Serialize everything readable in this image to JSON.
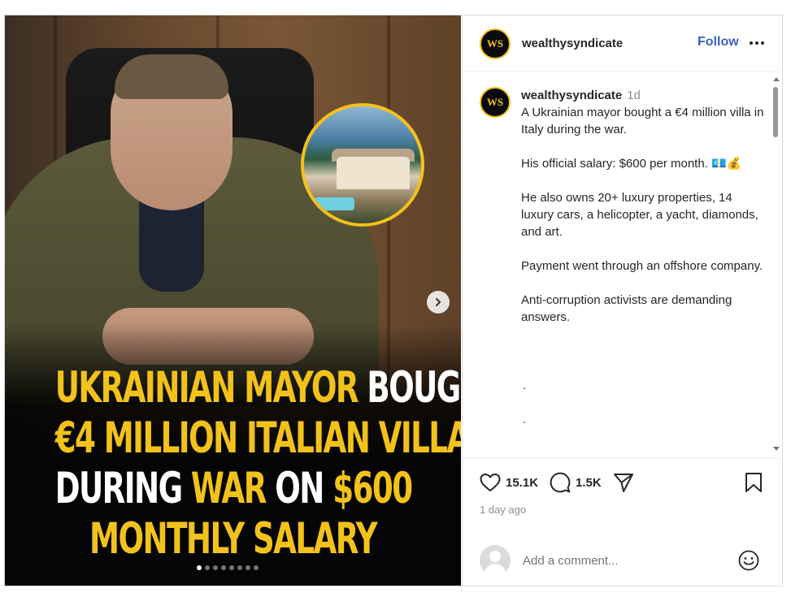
{
  "account": {
    "username": "wealthysyndicate",
    "avatar_initials": "WS",
    "follow_label": "Follow"
  },
  "post": {
    "headline_lines": [
      [
        {
          "text": "UKRAINIAN MAYOR ",
          "color": "yellow"
        },
        {
          "text": "BOUGHT",
          "color": "white"
        }
      ],
      [
        {
          "text": "€4 MILLION ITALIAN VILLA",
          "color": "yellow"
        }
      ],
      [
        {
          "text": "DURING ",
          "color": "white"
        },
        {
          "text": "WAR ",
          "color": "yellow"
        },
        {
          "text": "ON ",
          "color": "white"
        },
        {
          "text": "$600",
          "color": "yellow"
        }
      ],
      [
        {
          "text": "MONTHLY SALARY",
          "color": "yellow"
        }
      ]
    ],
    "carousel": {
      "total_slides": 8,
      "active_index": 0
    }
  },
  "caption": {
    "username": "wealthysyndicate",
    "time": "1d",
    "paragraphs": [
      "A Ukrainian mayor bought a €4 million villa in Italy during the war.",
      "His official salary: $600 per month. 💶💰",
      "He also owns 20+ luxury properties, 14 luxury cars, a helicopter, a yacht, diamonds, and art.",
      "Payment went through an offshore company.",
      "Anti-corruption activists are demanding answers."
    ],
    "trailing_dots": [
      ".",
      "."
    ]
  },
  "actions": {
    "likes": "15.1K",
    "comments": "1.5K",
    "posted_ago": "1 day ago"
  },
  "comment_box": {
    "placeholder": "Add a comment..."
  },
  "colors": {
    "accent_yellow": "#f2c21b",
    "follow_blue": "#3b5fc0",
    "muted_gray": "#8e8e8e"
  }
}
